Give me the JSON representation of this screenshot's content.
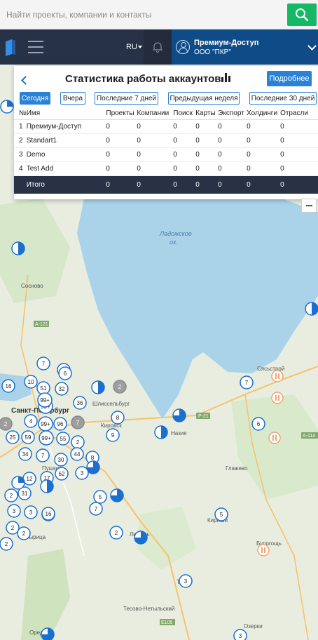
{
  "search": {
    "placeholder": "Найти проекты, компании и контакты",
    "value": ""
  },
  "topnav": {
    "lang": "RU",
    "user_name": "Премиум-Доступ",
    "user_org": "ООО \"ПКР\""
  },
  "panel": {
    "title": "Статистика работы аккаунтов",
    "more_label": "Подробнее",
    "periods": [
      "Сегодня",
      "Вчера",
      "Последние 7 дней",
      "Предыдущая неделя",
      "Последние 30 дней"
    ],
    "active_period": "Сегодня",
    "columns": [
      "№",
      "Имя",
      "Проекты",
      "Компании",
      "Поиск",
      "Карты",
      "Экспорт",
      "Холдинги",
      "Отрасли"
    ],
    "rows": [
      {
        "num": "1",
        "name": "Премиум-Доступ",
        "vals": [
          "0",
          "0",
          "0",
          "0",
          "0",
          "0",
          "0"
        ]
      },
      {
        "num": "2",
        "name": "Standart1",
        "vals": [
          "0",
          "0",
          "0",
          "0",
          "0",
          "0",
          "0"
        ]
      },
      {
        "num": "3",
        "name": "Demo",
        "vals": [
          "0",
          "0",
          "0",
          "0",
          "0",
          "0",
          "0"
        ]
      },
      {
        "num": "4",
        "name": "Test Add",
        "vals": [
          "0",
          "0",
          "0",
          "0",
          "0",
          "0",
          "0"
        ]
      }
    ],
    "total": {
      "label": "Итого",
      "vals": [
        "0",
        "0",
        "0",
        "0",
        "0",
        "0",
        "0"
      ]
    }
  },
  "map": {
    "lake_label_line1": "Ладожское",
    "lake_label_line2": "оз.",
    "places": [
      "Сосново",
      "Санкт-Петербург",
      "Шлиссельбург",
      "Кировск",
      "Назия",
      "Пушкин",
      "Глажево",
      "Кириши",
      "Любань",
      "Тосно",
      "Сясьстрой",
      "Будогощь",
      "Тесово-Нетыльский",
      "Оредеж",
      "Озерки",
      "Вырица"
    ],
    "road_labels": [
      "A-121",
      "P-21",
      "A-114",
      "E105"
    ],
    "clusters": [
      "6",
      "7",
      "10",
      "16",
      "51",
      "32",
      "99+",
      "36",
      "4",
      "99+",
      "7",
      "96",
      "2",
      "25",
      "59",
      "99+",
      "55",
      "2",
      "34",
      "7",
      "44",
      "8",
      "30",
      "12",
      "62",
      "17",
      "3",
      "2",
      "31",
      "3",
      "16",
      "2",
      "3",
      "7",
      "5",
      "9",
      "8",
      "6",
      "2",
      "7",
      "5",
      "2",
      "3",
      "3",
      "2",
      "6",
      "99+",
      "2",
      "16"
    ]
  }
}
